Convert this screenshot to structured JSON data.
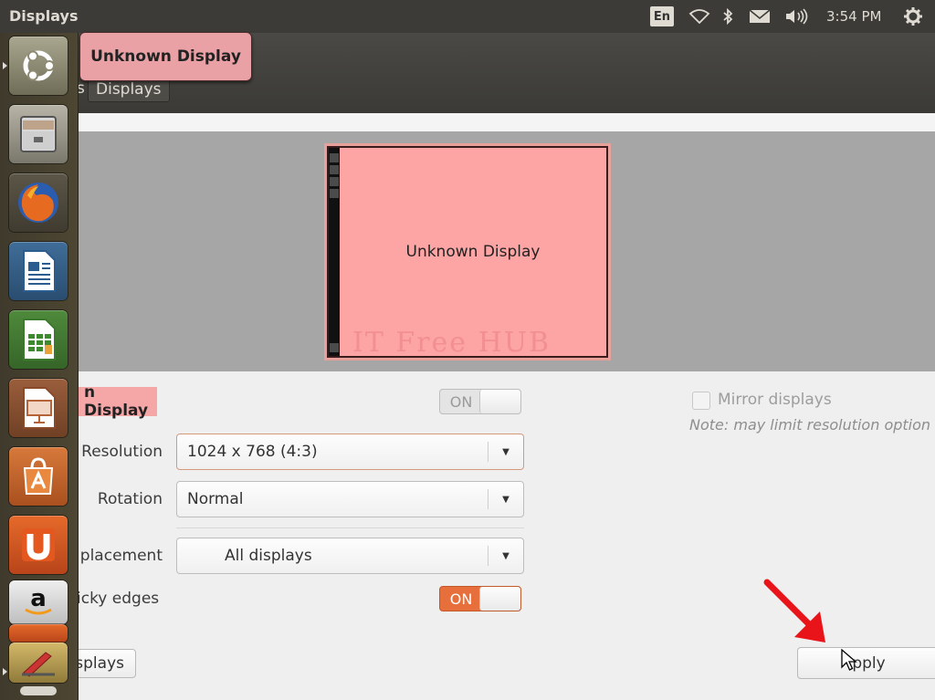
{
  "top_panel": {
    "app_title": "Displays",
    "keyboard_layout": "En",
    "time": "3:54 PM",
    "indicators": [
      "wifi-icon",
      "bluetooth-icon",
      "mail-icon",
      "volume-icon",
      "gear-icon"
    ]
  },
  "header": {
    "tooltip": "Unknown Display",
    "tooltip_behind": "ays",
    "breadcrumb_prev": "s",
    "breadcrumb_current": "Displays"
  },
  "arrangement": {
    "monitor_label": "Unknown Display",
    "watermark": "IT Free HUB"
  },
  "settings": {
    "display_name": "n Display",
    "power_toggle": "ON",
    "resolution_label": "Resolution",
    "resolution_value": "1024 x 768 (4:3)",
    "rotation_label": "Rotation",
    "rotation_value": "Normal",
    "launcher_label": "placement",
    "launcher_value": "All displays",
    "sticky_label": "icky edges",
    "sticky_toggle": "ON",
    "mirror_label": "Mirror displays",
    "mirror_note": "Note: may limit resolution option",
    "detect_button": "splays",
    "apply_button": "Apply",
    "apply_button_visible": "pply"
  },
  "launcher": {
    "items": [
      "dash-home-icon",
      "files-icon",
      "firefox-icon",
      "writer-icon",
      "calc-icon",
      "impress-icon",
      "software-center-icon",
      "ubuntu-one-icon",
      "amazon-icon",
      "system-settings-icon"
    ]
  },
  "colors": {
    "accent_orange": "#e76f3b",
    "monitor_pink": "#fda4a5",
    "panel": "#3c3b37",
    "arrow_red": "#e8141a"
  }
}
